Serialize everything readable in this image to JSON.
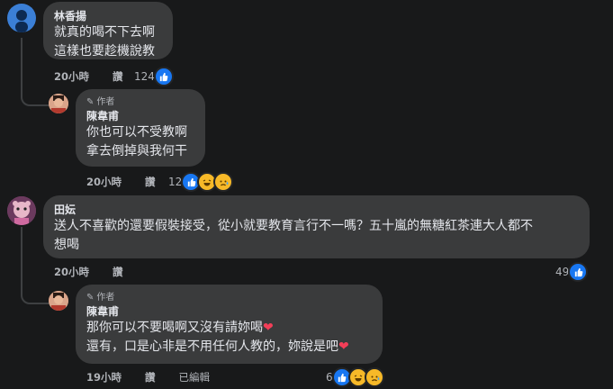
{
  "comments": [
    {
      "name": "林香揚",
      "lines": "就真的喝不下去啊\n這樣也要趁機說教",
      "time": "20小時",
      "reply": "讚",
      "count": "124"
    },
    {
      "author_badge": "作者",
      "name": "陳韋甫",
      "lines": "你也可以不受教啊\n拿去倒掉與我何干",
      "time": "20小時",
      "reply": "讚",
      "count": "12"
    },
    {
      "name": "田妘",
      "lines": "送人不喜歡的還要假裝接受，從小就要教育言行不一嗎？五十嵐的無糖紅茶連大人都不\n想喝",
      "time": "20小時",
      "reply": "讚",
      "count": "49"
    },
    {
      "author_badge": "作者",
      "name": "陳韋甫",
      "line1": "那你可以不要喝啊又沒有請妳喝",
      "line2": "還有，口是心非是不用任何人教的，妳說是吧",
      "time": "19小時",
      "reply": "讚",
      "edited": "已編輯",
      "count": "6"
    }
  ],
  "icons": [
    "like-icon",
    "haha-icon",
    "sad-icon",
    "heart-icon",
    "pencil-icon"
  ],
  "colors": {
    "like": "#1877f2",
    "haha": "#f7b928",
    "love": "#f33e58",
    "bubble": "#3a3b3c"
  }
}
